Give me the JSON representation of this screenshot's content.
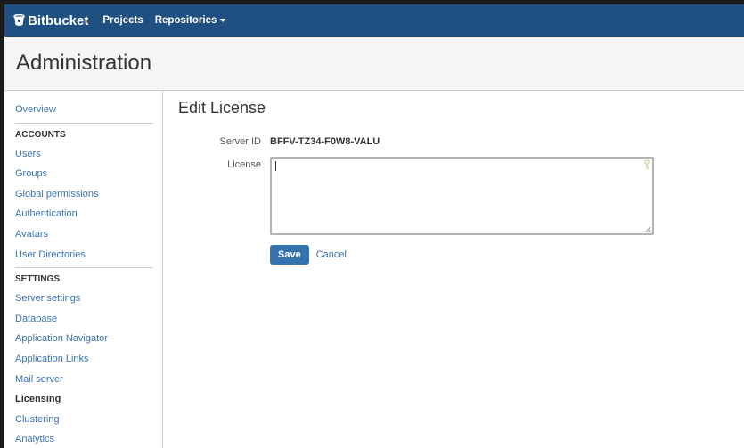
{
  "topbar": {
    "logo_text": "Bitbucket",
    "logo_icon": "bitbucket-bucket-icon",
    "nav": [
      {
        "label": "Projects"
      },
      {
        "label": "Repositories"
      }
    ],
    "background": "#205081"
  },
  "header": {
    "title": "Administration"
  },
  "sidebar": {
    "overview": "Overview",
    "accounts_heading": "ACCOUNTS",
    "accounts": [
      "Users",
      "Groups",
      "Global permissions",
      "Authentication",
      "Avatars",
      "User Directories"
    ],
    "settings_heading": "SETTINGS",
    "settings": [
      "Server settings",
      "Database",
      "Application Navigator",
      "Application Links",
      "Mail server",
      "Licensing",
      "Clustering",
      "Analytics"
    ],
    "active_item": "Licensing"
  },
  "main": {
    "title": "Edit License",
    "server_id_label": "Server ID",
    "server_id_value": "BFFV-TZ34-F0W8-VALU",
    "license_label": "License",
    "license_value": "",
    "save_label": "Save",
    "cancel_label": "Cancel"
  },
  "colors": {
    "accent": "#3572b0",
    "link": "#3b73af"
  }
}
